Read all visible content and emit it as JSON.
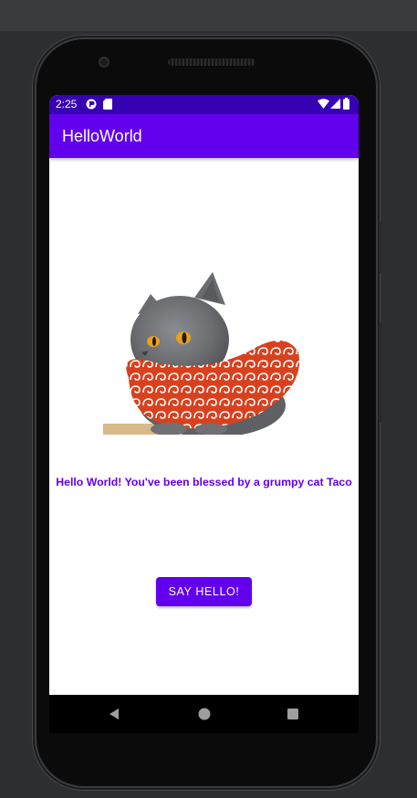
{
  "status_bar": {
    "time": "2:25",
    "icons": [
      "notification-icon",
      "sd-card-icon",
      "wifi-icon",
      "signal-icon",
      "battery-icon"
    ]
  },
  "app_bar": {
    "title": "HelloWorld"
  },
  "content": {
    "image": "grumpy-cat-image",
    "greeting": "Hello World! You've been blessed by a grumpy cat Taco",
    "button_label": "SAY HELLO!"
  },
  "nav_bar": {
    "icons": [
      "back-icon",
      "home-icon",
      "recents-icon"
    ]
  },
  "colors": {
    "primary": "#6200ee",
    "primary_dark": "#3700b3",
    "background": "#ffffff"
  }
}
